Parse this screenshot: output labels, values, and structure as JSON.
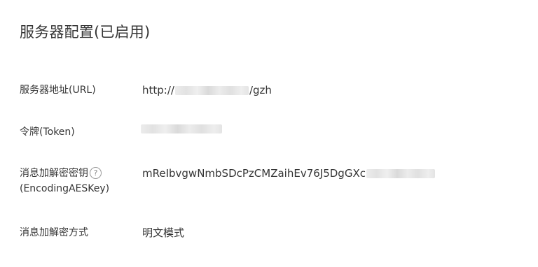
{
  "section": {
    "title": "服务器配置(已启用)"
  },
  "fields": {
    "url": {
      "label": "服务器地址(URL)",
      "value_prefix": "http://",
      "value_suffix": "/gzh"
    },
    "token": {
      "label": "令牌(Token)"
    },
    "aes_key": {
      "label_line1": "消息加解密密钥",
      "label_line2": "(EncodingAESKey)",
      "help_symbol": "?",
      "value_visible": "mReIbvgwNmbSDcPzCMZaihEv76J5DgGXc"
    },
    "encrypt_mode": {
      "label": "消息加解密方式",
      "value": "明文模式"
    }
  },
  "icons": {
    "help": "question-circle-icon"
  }
}
